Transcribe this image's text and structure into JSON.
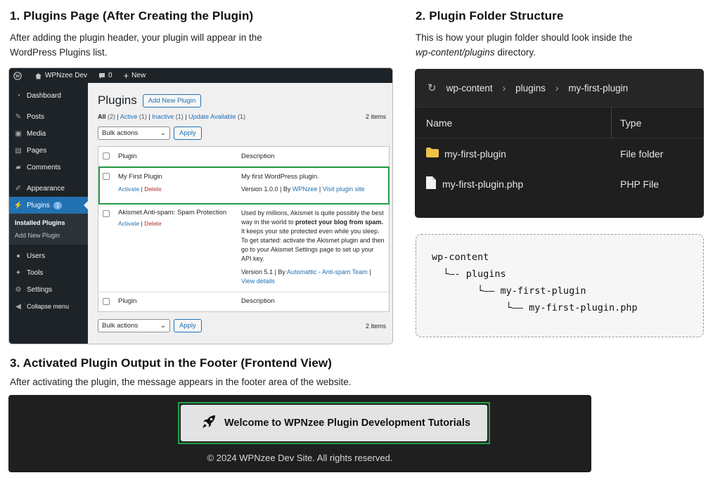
{
  "section1": {
    "heading": "1. Plugins Page (After Creating the Plugin)",
    "desc_line1": "After adding the plugin header, your plugin will appear in the",
    "desc_line2": "WordPress Plugins list."
  },
  "section2": {
    "heading": "2. Plugin Folder Structure",
    "desc_line1": "This is how your plugin folder should look inside the",
    "desc_path": "wp-content/plugins",
    "desc_tail": " directory."
  },
  "section3": {
    "heading": "3. Activated Plugin Output in the Footer (Frontend View)",
    "desc": "After activating the plugin, the message appears in the footer area of the website."
  },
  "wp": {
    "site_name": "WPNzee Dev",
    "comment_count": "0",
    "new_label": "New",
    "menu": [
      {
        "label": "Dashboard",
        "icon": "dashboard-icon"
      },
      {
        "label": "Posts",
        "icon": "pin-icon"
      },
      {
        "label": "Media",
        "icon": "media-icon"
      },
      {
        "label": "Pages",
        "icon": "pages-icon"
      },
      {
        "label": "Comments",
        "icon": "comments-icon"
      },
      {
        "label": "Appearance",
        "icon": "brush-icon"
      },
      {
        "label": "Plugins",
        "icon": "plug-icon",
        "badge": "1"
      },
      {
        "label": "Users",
        "icon": "user-icon"
      },
      {
        "label": "Tools",
        "icon": "wrench-icon"
      },
      {
        "label": "Settings",
        "icon": "settings-icon"
      },
      {
        "label": "Collapse menu",
        "icon": "collapse-icon"
      }
    ],
    "submenu": [
      "Installed Plugins",
      "Add New Plugin"
    ],
    "page_title": "Plugins",
    "add_new": "Add New Plugin",
    "filters": {
      "all": "All",
      "all_count": "(2)",
      "active": "Active",
      "active_count": "(1)",
      "inactive": "Inactive",
      "inactive_count": "(1)",
      "update": "Update Available",
      "update_count": "(1)"
    },
    "items_count": "2 items",
    "bulk_actions": "Bulk actions",
    "apply": "Apply",
    "col_plugin": "Plugin",
    "col_desc": "Description",
    "plugins": [
      {
        "name": "My First Plugin",
        "action1": "Activate",
        "action2": "Delete",
        "desc": "My first WordPress plugin.",
        "version": "Version 1.0.0 | By ",
        "author": "WPNzee",
        "sep": " | ",
        "site": "Visit plugin site"
      },
      {
        "name": "Akismet Anti-spam: Spam Protection",
        "action1": "Activate",
        "action2": "Delete",
        "desc_a": "Used by millions, Akismet is quite possibly the best way in the world to ",
        "desc_b": "protect your blog from spam.",
        "desc_c": " It keeps your site protected even while you sleep. To get started: activate the Akismet plugin and then go to your Akismet Settings page to set up your API key.",
        "version": "Version 5.1 | By ",
        "author": "Automattic - Anti-spam Team",
        "sep": " | ",
        "details": "View details"
      }
    ]
  },
  "explorer": {
    "crumbs": [
      "wp-content",
      "plugins",
      "my-first-plugin"
    ],
    "col_name": "Name",
    "col_type": "Type",
    "rows": [
      {
        "name": "my-first-plugin",
        "type": "File folder",
        "icon": "folder-icon"
      },
      {
        "name": "my-first-plugin.php",
        "type": "PHP File",
        "icon": "file-icon"
      }
    ]
  },
  "tree": {
    "lines": [
      "wp-content",
      "  └—- plugins",
      "        └—— my-first-plugin",
      "             └—— my-first-plugin.php"
    ]
  },
  "footer": {
    "message": "Welcome to WPNzee Plugin Development Tutorials",
    "copyright": "© 2024 WPNzee Dev Site. All rights reserved."
  },
  "colors": {
    "wp_blue": "#2271b1",
    "highlight_green": "#22a04a",
    "dark_bg": "#1f1f1f"
  }
}
